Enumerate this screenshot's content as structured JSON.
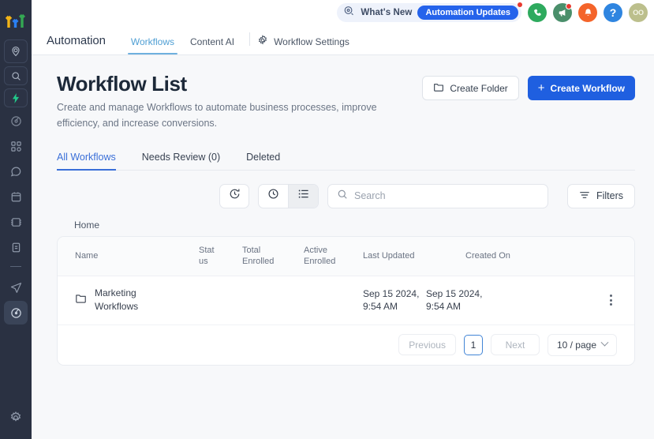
{
  "sidebar": {
    "logo_name": "growth-arrows-logo",
    "logo_colors": [
      "#f2b417",
      "#2a7ff2",
      "#34a853"
    ],
    "items": [
      {
        "name": "location-pin-icon",
        "label": "Location"
      },
      {
        "name": "search-icon",
        "label": "Search"
      },
      {
        "name": "lightning-bolt-icon",
        "label": "Quick Actions"
      },
      {
        "name": "dashboard-icon",
        "label": "Dashboard"
      },
      {
        "name": "apps-grid-icon",
        "label": "Apps"
      },
      {
        "name": "conversations-icon",
        "label": "Conversations"
      },
      {
        "name": "calendar-icon",
        "label": "Calendar"
      },
      {
        "name": "contacts-icon",
        "label": "Contacts"
      },
      {
        "name": "opportunities-icon",
        "label": "Opportunities"
      },
      {
        "name": "payments-icon",
        "label": "Payments"
      },
      {
        "name": "marketing-send-icon",
        "label": "Marketing"
      },
      {
        "name": "automation-icon",
        "label": "Automation"
      },
      {
        "name": "settings-gear-icon",
        "label": "Settings"
      }
    ]
  },
  "topbar": {
    "whats_new_label": "What's New",
    "whats_new_pill": "Automation Updates",
    "whats_new_icon": "sparkle-badge-icon",
    "icons": [
      {
        "name": "phone-call-icon",
        "color": "#2eaa5e",
        "glyph": "phone"
      },
      {
        "name": "megaphone-announcement-icon",
        "color": "#4a8f6b",
        "glyph": "megaphone",
        "badge": true
      },
      {
        "name": "notification-bell-icon",
        "color": "#f4642a",
        "glyph": "bell"
      },
      {
        "name": "help-question-icon",
        "color": "#2f85e0",
        "glyph": "question"
      },
      {
        "name": "user-avatar",
        "color": "#bcbf8c",
        "glyph": "OO"
      }
    ]
  },
  "nav": {
    "brand": "Automation",
    "tabs": [
      {
        "label": "Workflows",
        "active": true
      },
      {
        "label": "Content AI",
        "active": false
      }
    ],
    "settings_label": "Workflow Settings",
    "settings_icon": "gear-icon"
  },
  "page": {
    "title": "Workflow List",
    "subtitle": "Create and manage Workflows to automate business processes, improve efficiency, and increase conversions.",
    "create_folder_label": "Create Folder",
    "create_folder_icon": "folder-icon",
    "create_workflow_label": "Create Workflow",
    "create_workflow_icon": "plus-icon"
  },
  "subtabs": [
    {
      "label": "All Workflows",
      "active": true
    },
    {
      "label": "Needs Review (0)",
      "active": false
    },
    {
      "label": "Deleted",
      "active": false
    }
  ],
  "toolbar": {
    "history_icon": "clock-refresh-icon",
    "recent_icon": "clock-icon",
    "list_view_icon": "list-view-icon",
    "list_view_active": true,
    "search_placeholder": "Search",
    "search_value": "",
    "search_icon": "search-icon",
    "filters_label": "Filters",
    "filters_icon": "filter-icon"
  },
  "breadcrumb": "Home",
  "table": {
    "columns": [
      {
        "key": "name",
        "label": "Name"
      },
      {
        "key": "status",
        "label": "Stat\nus"
      },
      {
        "key": "total_enrolled",
        "label": "Total\nEnrolled"
      },
      {
        "key": "active_enrolled",
        "label": "Active\nEnrolled"
      },
      {
        "key": "last_updated",
        "label": "Last Updated"
      },
      {
        "key": "created_on",
        "label": "Created On"
      }
    ],
    "rows": [
      {
        "icon": "folder-icon",
        "name": "Marketing Workflows",
        "status": "",
        "total_enrolled": "",
        "active_enrolled": "",
        "last_updated": "Sep 15 2024, 9:54 AM",
        "created_on": "Sep 15 2024, 9:54 AM",
        "menu_icon": "kebab-menu-icon"
      }
    ]
  },
  "pagination": {
    "previous_label": "Previous",
    "page_number": "1",
    "next_label": "Next",
    "page_size_label": "10 / page",
    "chevron_icon": "chevron-down-icon"
  },
  "colors": {
    "accent_blue": "#1f5fe0",
    "tab_blue": "#3a6fd8",
    "sidebar_bg": "#2a3142",
    "page_bg": "#f7f8fa"
  }
}
